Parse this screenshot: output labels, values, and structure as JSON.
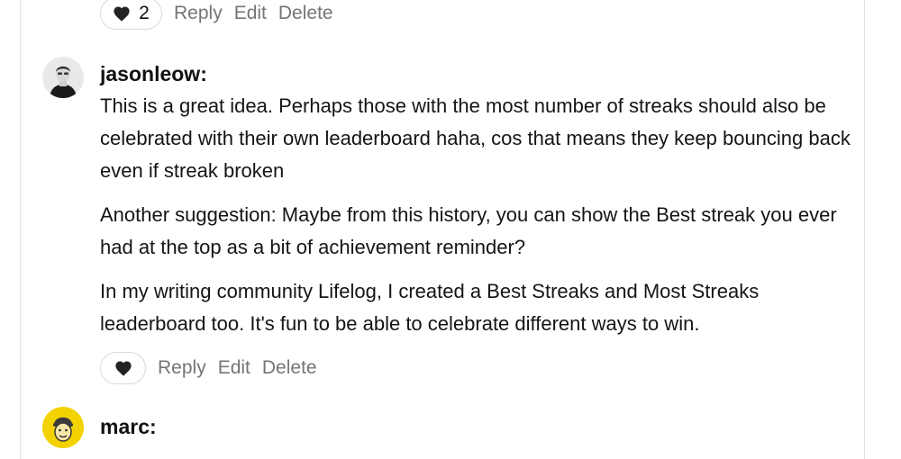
{
  "comments": [
    {
      "actions": {
        "like_count": "2",
        "reply": "Reply",
        "edit": "Edit",
        "delete": "Delete"
      }
    },
    {
      "author": "jasonleow:",
      "paragraphs": [
        "This is a great idea. Perhaps those with the most number of streaks should also be celebrated with their own leaderboard haha, cos that means they keep bouncing back even if streak broken",
        "Another suggestion: Maybe from this history, you can show the Best streak you ever had at the top as a bit of achievement reminder?",
        "In my writing community Lifelog, I created a Best Streaks and Most Streaks leaderboard too. It's fun to be able to celebrate different ways to win."
      ],
      "actions": {
        "reply": "Reply",
        "edit": "Edit",
        "delete": "Delete"
      }
    },
    {
      "author": "marc:"
    }
  ],
  "icons": {
    "like": "heart-icon"
  },
  "colors": {
    "text": "#151515",
    "muted": "#757575",
    "border": "#d9d9d9",
    "marc_avatar_bg": "#f2d200"
  }
}
